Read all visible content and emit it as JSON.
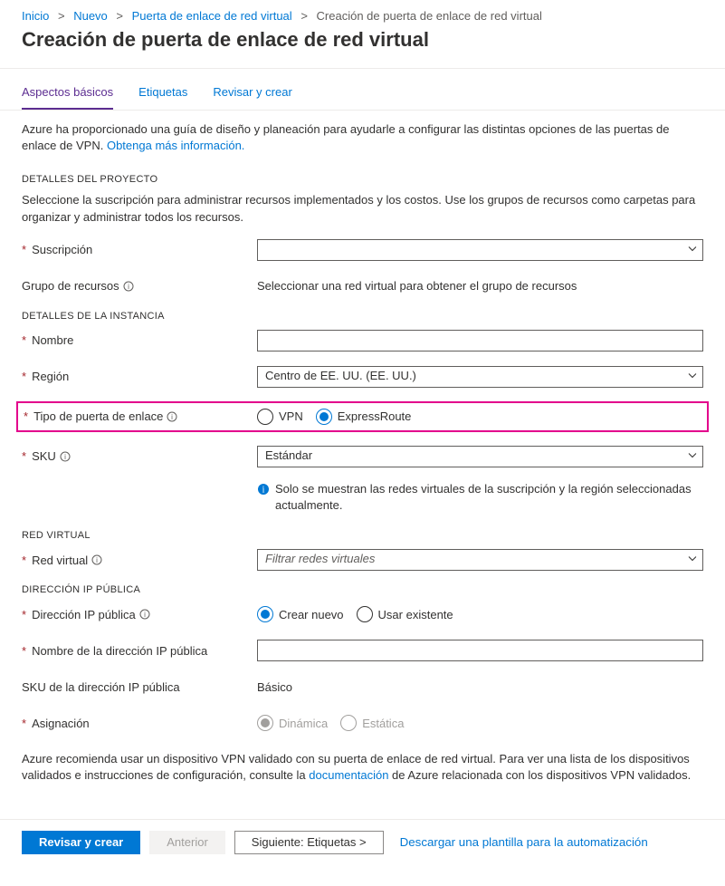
{
  "breadcrumb": {
    "items": [
      "Inicio",
      "Nuevo",
      "Puerta de enlace de red virtual"
    ],
    "current": "Creación de puerta de enlace de red virtual"
  },
  "pageTitle": "Creación de puerta de enlace de red virtual",
  "tabs": {
    "basics": "Aspectos básicos",
    "tags": "Etiquetas",
    "review": "Revisar y crear"
  },
  "intro": {
    "text1": "Azure ha proporcionado una guía de diseño y planeación para ayudarle a configurar las distintas opciones de las puertas de enlace de VPN. ",
    "link": "Obtenga más información."
  },
  "project": {
    "header": "DETALLES DEL PROYECTO",
    "desc": "Seleccione la suscripción para administrar recursos implementados y los costos. Use los grupos de recursos como carpetas para organizar y administrar todos los recursos.",
    "subscriptionLabel": "Suscripción",
    "subscriptionValue": "",
    "rgLabel": "Grupo de recursos",
    "rgValue": "Seleccionar una red virtual para obtener el grupo de recursos"
  },
  "instance": {
    "header": "DETALLES DE LA INSTANCIA",
    "nameLabel": "Nombre",
    "nameValue": "",
    "regionLabel": "Región",
    "regionValue": "Centro de EE. UU. (EE. UU.)",
    "gatewayTypeLabel": "Tipo de puerta de enlace",
    "gatewayVpn": "VPN",
    "gatewayEr": "ExpressRoute",
    "skuLabel": "SKU",
    "skuValue": "Estándar",
    "infoNote": "Solo se muestran las redes virtuales de la suscripción y la región seleccionadas actualmente."
  },
  "vnet": {
    "header": "RED VIRTUAL",
    "label": "Red virtual",
    "placeholder": "Filtrar redes virtuales"
  },
  "publicIp": {
    "header": "DIRECCIÓN IP PÚBLICA",
    "ipLabel": "Dirección IP pública",
    "createNew": "Crear nuevo",
    "useExisting": "Usar existente",
    "ipNameLabel": "Nombre de la dirección IP pública",
    "ipNameValue": "",
    "ipSkuLabel": "SKU de la dirección IP pública",
    "ipSkuValue": "Básico",
    "assignLabel": "Asignación",
    "dynamic": "Dinámica",
    "static": "Estática"
  },
  "footer": {
    "text1": "Azure recomienda usar un dispositivo VPN validado con su puerta de enlace de red virtual. Para ver una lista de los dispositivos validados e instrucciones de configuración, consulte la ",
    "link": "documentación",
    "text2": " de Azure relacionada con los dispositivos VPN validados."
  },
  "buttons": {
    "review": "Revisar y crear",
    "prev": "Anterior",
    "next": "Siguiente: Etiquetas >",
    "download": "Descargar una plantilla para la automatización"
  }
}
